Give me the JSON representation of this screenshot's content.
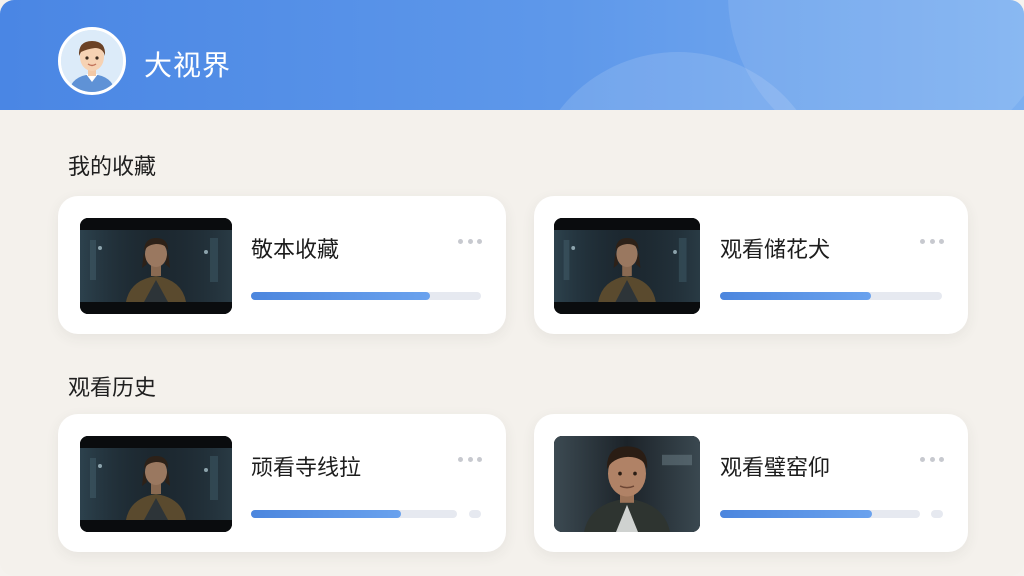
{
  "header": {
    "title": "大视界",
    "avatar_icon": "user-avatar-icon"
  },
  "sections": [
    {
      "title": "我的收藏",
      "cards": [
        {
          "title": "敬本收藏",
          "progress": 0.78,
          "thumb": "movie-still-man-wide"
        },
        {
          "title": "观看储花犬",
          "progress": 0.68,
          "thumb": "movie-still-man-wide"
        }
      ]
    },
    {
      "title": "观看历史",
      "cards": [
        {
          "title": "顽看寺线拉",
          "progress": 0.73,
          "thumb": "movie-still-man-wide"
        },
        {
          "title": "观看璧窑仰",
          "progress": 0.76,
          "thumb": "movie-still-man-closeup"
        }
      ]
    }
  ],
  "colors": {
    "header_start": "#4a86e4",
    "header_end": "#7cb0f1",
    "progress": "#4c86de",
    "background": "#f4f1ec"
  }
}
